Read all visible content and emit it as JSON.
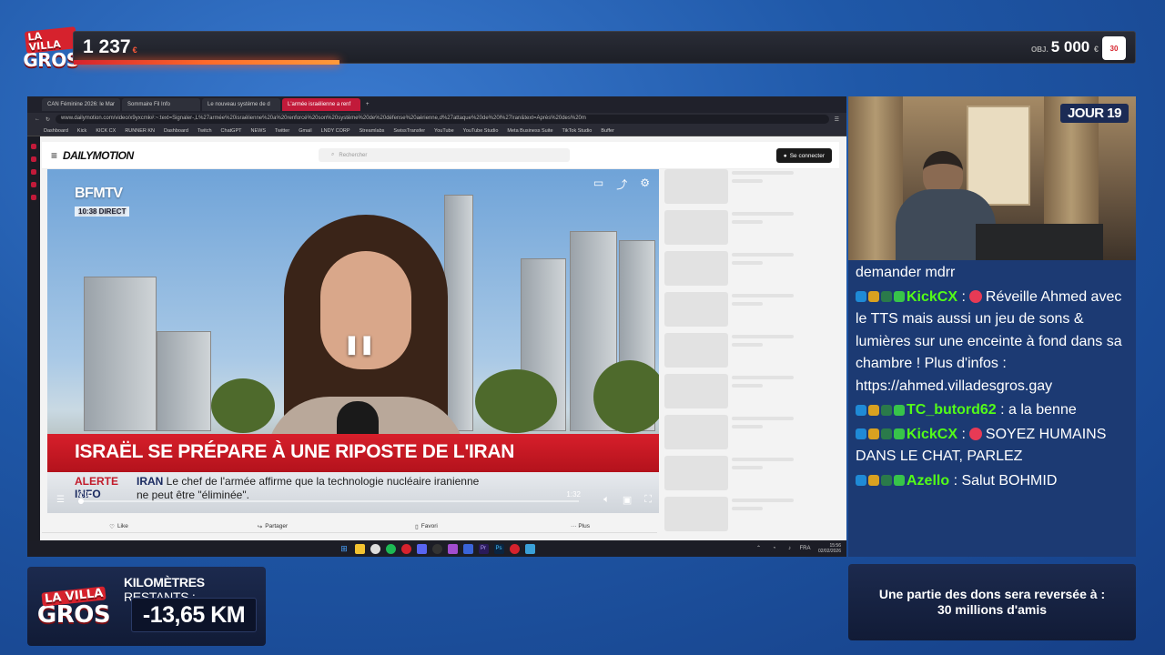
{
  "overlay": {
    "logo": {
      "line1": "LA VILLA",
      "line2": "GROS"
    },
    "counter": {
      "value": "1 237",
      "unit": "€"
    },
    "goal": {
      "prefix": "OBJ.",
      "value": "5 000",
      "unit": "€"
    },
    "badge": "30",
    "progress_fraction": 0.25,
    "day_badge": "JOUR 19",
    "km_label_bold": "KILOMÈTRES",
    "km_label_rest": " RESTANTS :",
    "km_value": "-13,65 KM",
    "donation_text_1": "Une partie des dons sera reversée à :",
    "donation_text_2": "30 millions d'amis"
  },
  "browser": {
    "tabs": [
      {
        "label": "CAN Féminine 2026: le Mar",
        "active": false
      },
      {
        "label": "Sommaire Fil Info",
        "active": false
      },
      {
        "label": "Le nouveau système de d",
        "active": false
      },
      {
        "label": "L'armée israélienne a renf",
        "active": true
      }
    ],
    "url": "www.dailymotion.com/video/x9yxcmk#:~:text=Signaler-,L%27armée%20israélienne%20a%20renforcé%20son%20système%20de%20défense%20aérienne,d%27attaque%20de%20l%27Iran&text=Après%20des%20m",
    "bookmarks": [
      "Dashboard",
      "Kick",
      "KICK CX",
      "RUNNER KN",
      "Dashboard",
      "Twitch",
      "ChatGPT",
      "NEWS",
      "Twitter",
      "Gmail",
      "LNDY CORP",
      "Streamlabs",
      "SwissTransfer",
      "YouTube",
      "YouTube Studio",
      "Meta Business Suite",
      "TikTok Studio",
      "Buffer"
    ],
    "site_brand": "DAILYMOTION",
    "search_placeholder": "Rechercher",
    "connect_label": "Se connecter",
    "actions": [
      "Like",
      "Partager",
      "Favori",
      "··· Plus"
    ]
  },
  "video": {
    "channel": "BFMTV",
    "channel_time": "10:38 DIRECT",
    "headline": "ISRAËL SE PRÉPARE À UNE RIPOSTE DE L'IRAN",
    "alert_line1": "ALERTE",
    "alert_line2": "INFO",
    "ticker_keyword": "IRAN",
    "ticker_text_1": " Le chef de l'armée affirme que la technologie nucléaire iranienne",
    "ticker_text_2": "ne peut être \"éliminée\".",
    "current_time": "0:00",
    "duration": "1:32",
    "progress_fraction": 0.0
  },
  "taskbar": {
    "time": "15:56",
    "date": "02/02/2026",
    "lang": "FRA"
  },
  "chat": {
    "messages": [
      {
        "user": "",
        "text": "demander mdrr",
        "color": "#ffffff"
      },
      {
        "user": "KickCX",
        "text": "Réveille Ahmed avec le TTS mais aussi un jeu de sons & lumières sur une enceinte à fond dans sa chambre ! Plus d'infos : https://ahmed.villadesgros.gay",
        "color": "#53fc18",
        "fire": true
      },
      {
        "user": "TC_butord62",
        "text": ": a la benne",
        "color": "#53fc18",
        "fire": false
      },
      {
        "user": "KickCX",
        "text": "SOYEZ HUMAINS DANS LE CHAT, PARLEZ",
        "color": "#53fc18",
        "fire": true
      },
      {
        "user": "Azello",
        "text": ": Salut BOHMID",
        "color": "#53fc18",
        "fire": false
      }
    ]
  },
  "colors": {
    "accent": "#d6222d",
    "chat_user": "#53fc18",
    "chat_bg": "#1c3a73"
  }
}
